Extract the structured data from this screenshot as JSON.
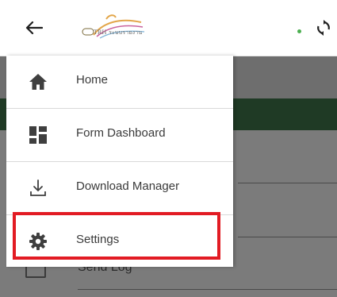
{
  "header": {
    "logo_text": "TRH ระบบรายงาน",
    "status_color": "#4caf50"
  },
  "drawer": {
    "items": [
      {
        "label": "Home",
        "icon": "home-icon"
      },
      {
        "label": "Form Dashboard",
        "icon": "dashboard-icon"
      },
      {
        "label": "Download Manager",
        "icon": "download-icon"
      },
      {
        "label": "Settings",
        "icon": "gear-icon"
      }
    ]
  },
  "background": {
    "partial_item_label": "Send Log"
  },
  "colors": {
    "highlight": "#e21b23",
    "icon": "#3f3f3f"
  }
}
